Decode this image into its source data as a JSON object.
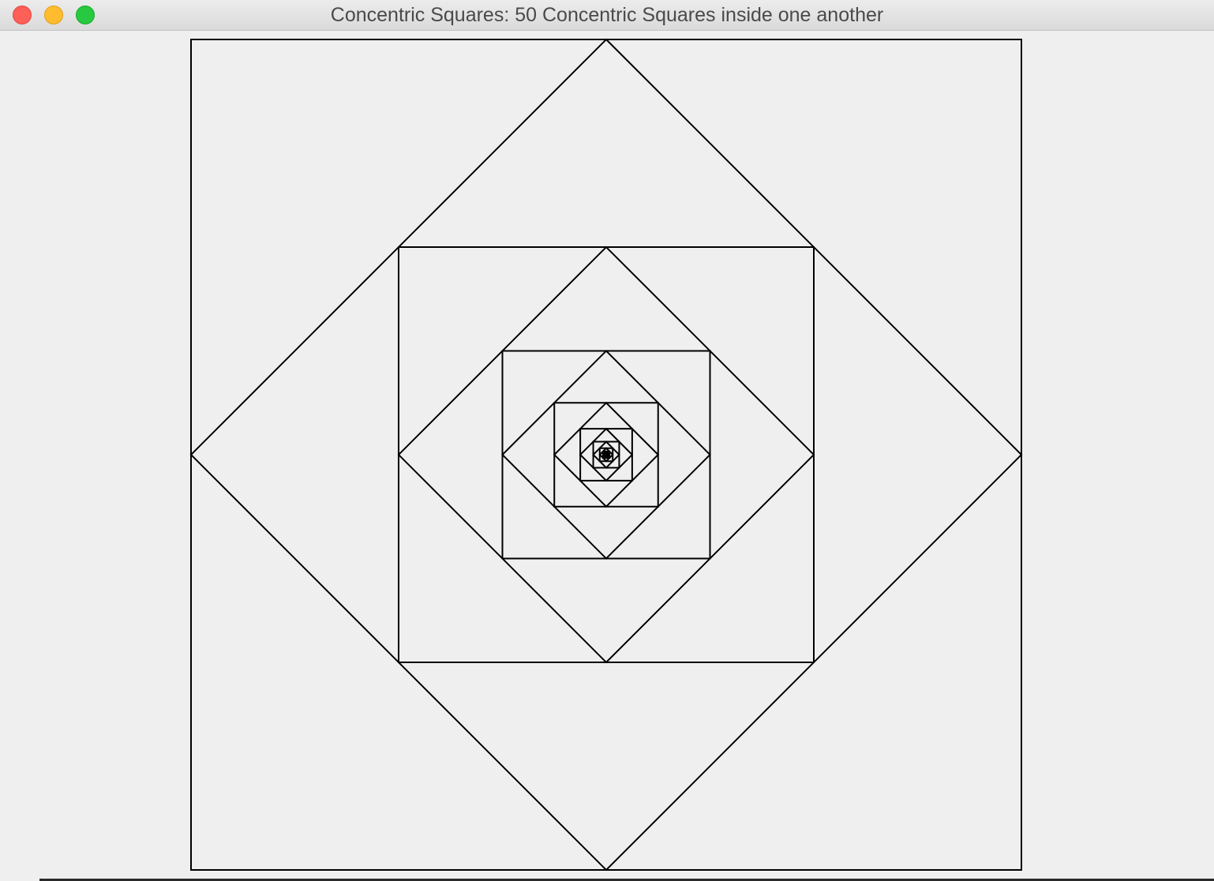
{
  "window": {
    "title": "Concentric Squares: 50 Concentric Squares inside one another"
  },
  "drawing": {
    "square_count": 50,
    "stroke_color": "#000000",
    "background_color": "#efefef"
  },
  "icons": {
    "close": "close-button-icon",
    "minimize": "minimize-button-icon",
    "zoom": "zoom-button-icon"
  }
}
